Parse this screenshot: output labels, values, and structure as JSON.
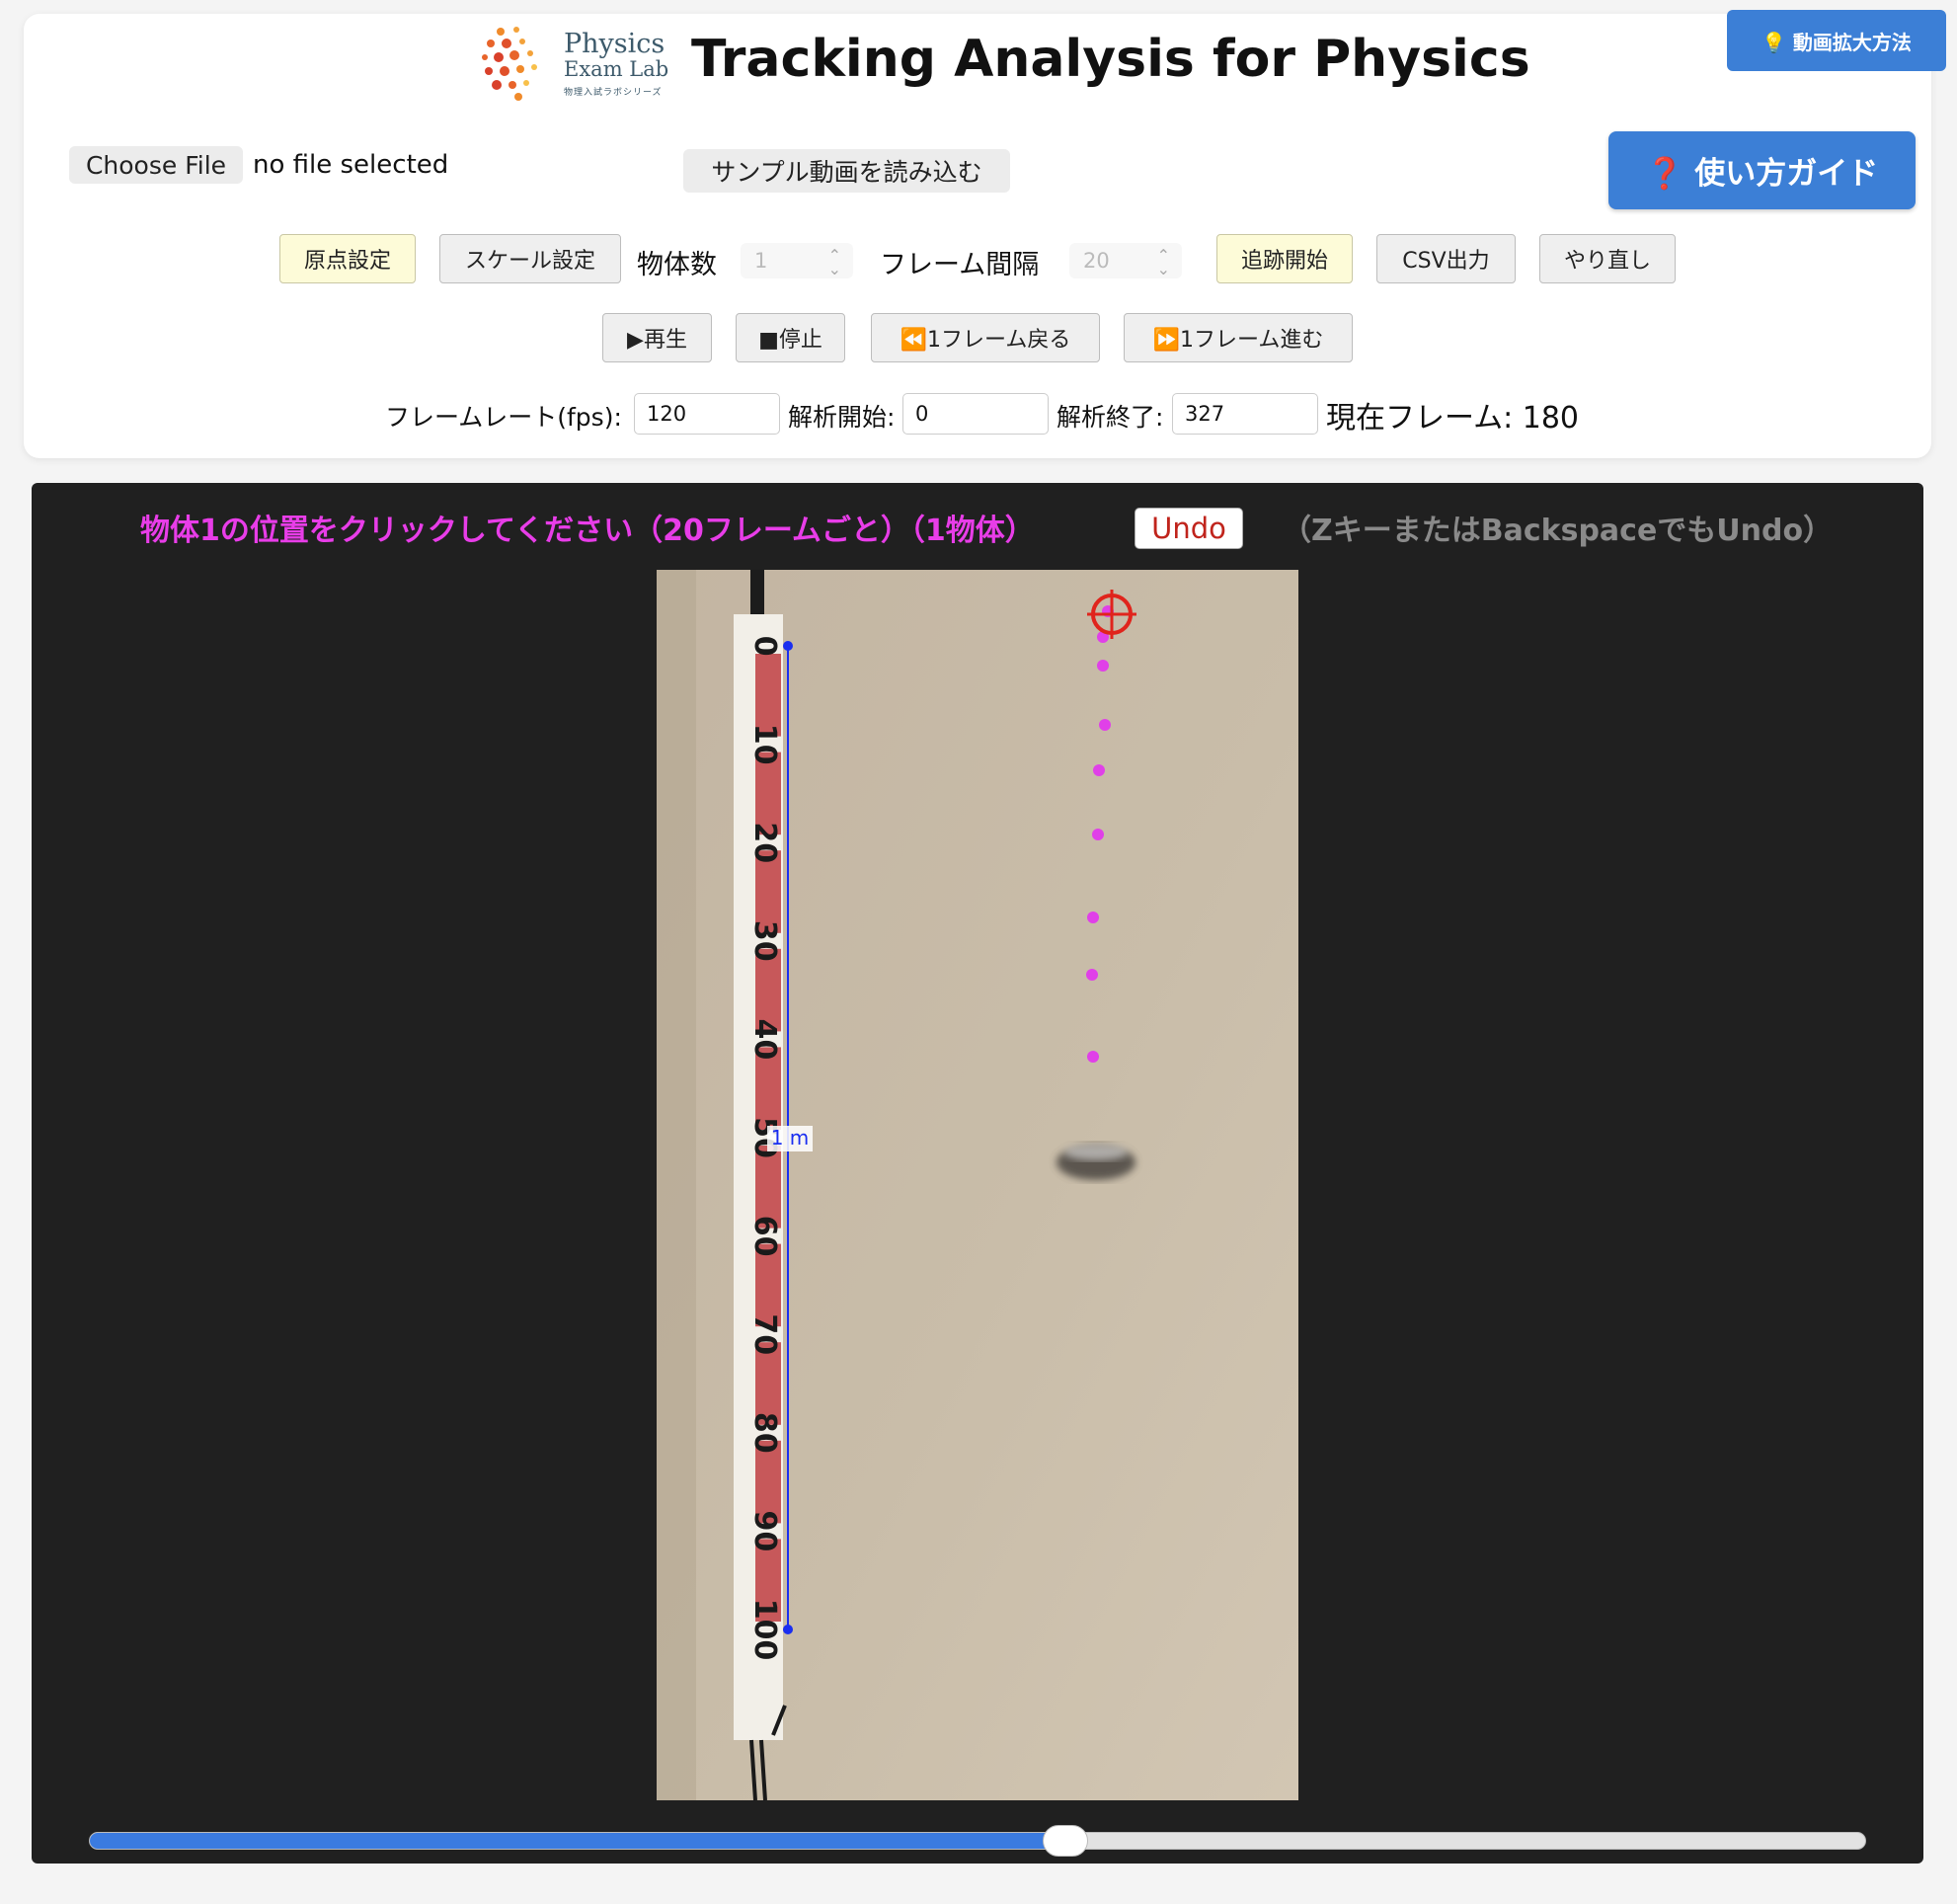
{
  "header": {
    "logo_line1": "Physics",
    "logo_line2": "Exam Lab",
    "logo_line3": "物理入試ラボシリーズ",
    "title": "Tracking Analysis for Physics",
    "zoom_help_label": "💡 動画拡大方法",
    "guide_label": "❓ 使い方ガイド"
  },
  "file": {
    "choose_label": "Choose File",
    "status": "no file selected",
    "sample_label": "サンプル動画を読み込む"
  },
  "toolbar": {
    "origin_label": "原点設定",
    "scale_label": "スケール設定",
    "objects_label": "物体数",
    "objects_value": "1",
    "interval_label": "フレーム間隔",
    "interval_value": "20",
    "track_label": "追跡開始",
    "csv_label": "CSV出力",
    "reset_label": "やり直し"
  },
  "playback": {
    "play_label": "▶再生",
    "stop_label": "■停止",
    "back_label": "⏪1フレーム戻る",
    "forward_label": "⏩1フレーム進む"
  },
  "params": {
    "fps_label": "フレームレート(fps):",
    "fps_value": "120",
    "start_label": "解析開始:",
    "start_value": "0",
    "end_label": "解析終了:",
    "end_value": "327",
    "current_frame_text": "現在フレーム: 180"
  },
  "canvas": {
    "instruction": "物体1の位置をクリックしてください（20フレームごと）（1物体）",
    "undo_label": "Undo",
    "undo_hint": "（ZキーまたはBackspaceでもUndo）",
    "scale_label": "1 m",
    "ruler_ticks": [
      "0",
      "10",
      "20",
      "30",
      "40",
      "50",
      "60",
      "70",
      "80",
      "90",
      "100"
    ],
    "point_color": "#e040e8",
    "crosshair_color": "#e0241c",
    "scale_line_color": "#1a2ef0"
  },
  "slider": {
    "progress": 0.55
  }
}
